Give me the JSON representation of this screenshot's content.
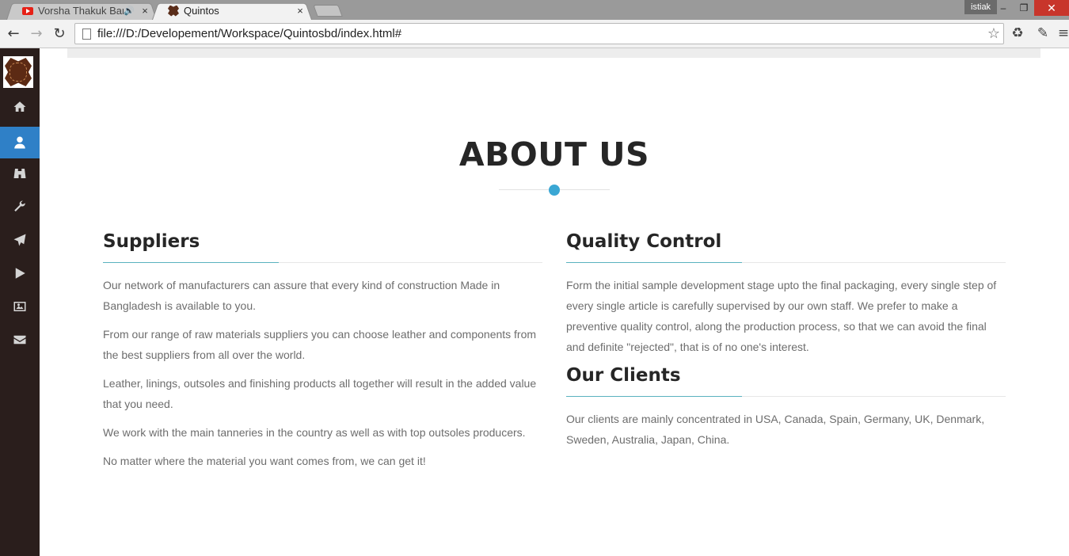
{
  "browser": {
    "tabs": [
      {
        "title": "Vorsha Thakuk Bangla",
        "close": "×",
        "audio": "🔊"
      },
      {
        "title": "Quintos",
        "close": "×"
      }
    ],
    "user": "istiak",
    "window_buttons": {
      "minimize": "–",
      "restore": "❐",
      "close": "✕"
    },
    "nav": {
      "back": "←",
      "forward": "→",
      "reload": "↻"
    },
    "url": "file:///D:/Developement/Workspace/Quintosbd/index.html#",
    "toolbar_icons": [
      "star-icon",
      "recycle-icon",
      "pencil-icon",
      "menu-icon"
    ]
  },
  "sidebar": {
    "items": [
      {
        "name": "home",
        "icon": "home-icon",
        "active": false
      },
      {
        "name": "about",
        "icon": "user-icon",
        "active": true
      },
      {
        "name": "binoculars",
        "icon": "binoculars-icon",
        "active": false
      },
      {
        "name": "services",
        "icon": "wrench-icon",
        "active": false
      },
      {
        "name": "send",
        "icon": "paper-plane-icon",
        "active": false
      },
      {
        "name": "video",
        "icon": "play-icon",
        "active": false
      },
      {
        "name": "gallery",
        "icon": "image-icon",
        "active": false
      },
      {
        "name": "contact",
        "icon": "envelope-icon",
        "active": false
      }
    ],
    "active_color": "#2f80c7",
    "background": "#2a1e1c"
  },
  "page": {
    "heading": "ABOUT US",
    "accent_color": "#3aa7d4",
    "suppliers": {
      "title": "Suppliers",
      "paragraphs": [
        "Our network of manufacturers can assure that every kind of construction Made in Bangladesh is available to you.",
        "From our range of raw materials suppliers you can choose leather and components from the best suppliers from all over the world.",
        "Leather, linings, outsoles and finishing products all together will result in the added value that you need.",
        "We work with the main tanneries in the country as well as with top outsoles producers.",
        "No matter where the material you want comes from, we can get it!"
      ]
    },
    "quality": {
      "title": "Quality Control",
      "paragraphs": [
        "Form the initial sample development stage upto the final packaging, every single step of every single article is carefully supervised by our own staff. We prefer to make a preventive quality control, along the production process, so that we can avoid the final and definite \"rejected\", that is of no one's interest."
      ]
    },
    "clients": {
      "title": "Our Clients",
      "paragraphs": [
        "Our clients are mainly concentrated in USA, Canada, Spain, Germany, UK, Denmark, Sweden, Australia, Japan, China."
      ]
    }
  }
}
